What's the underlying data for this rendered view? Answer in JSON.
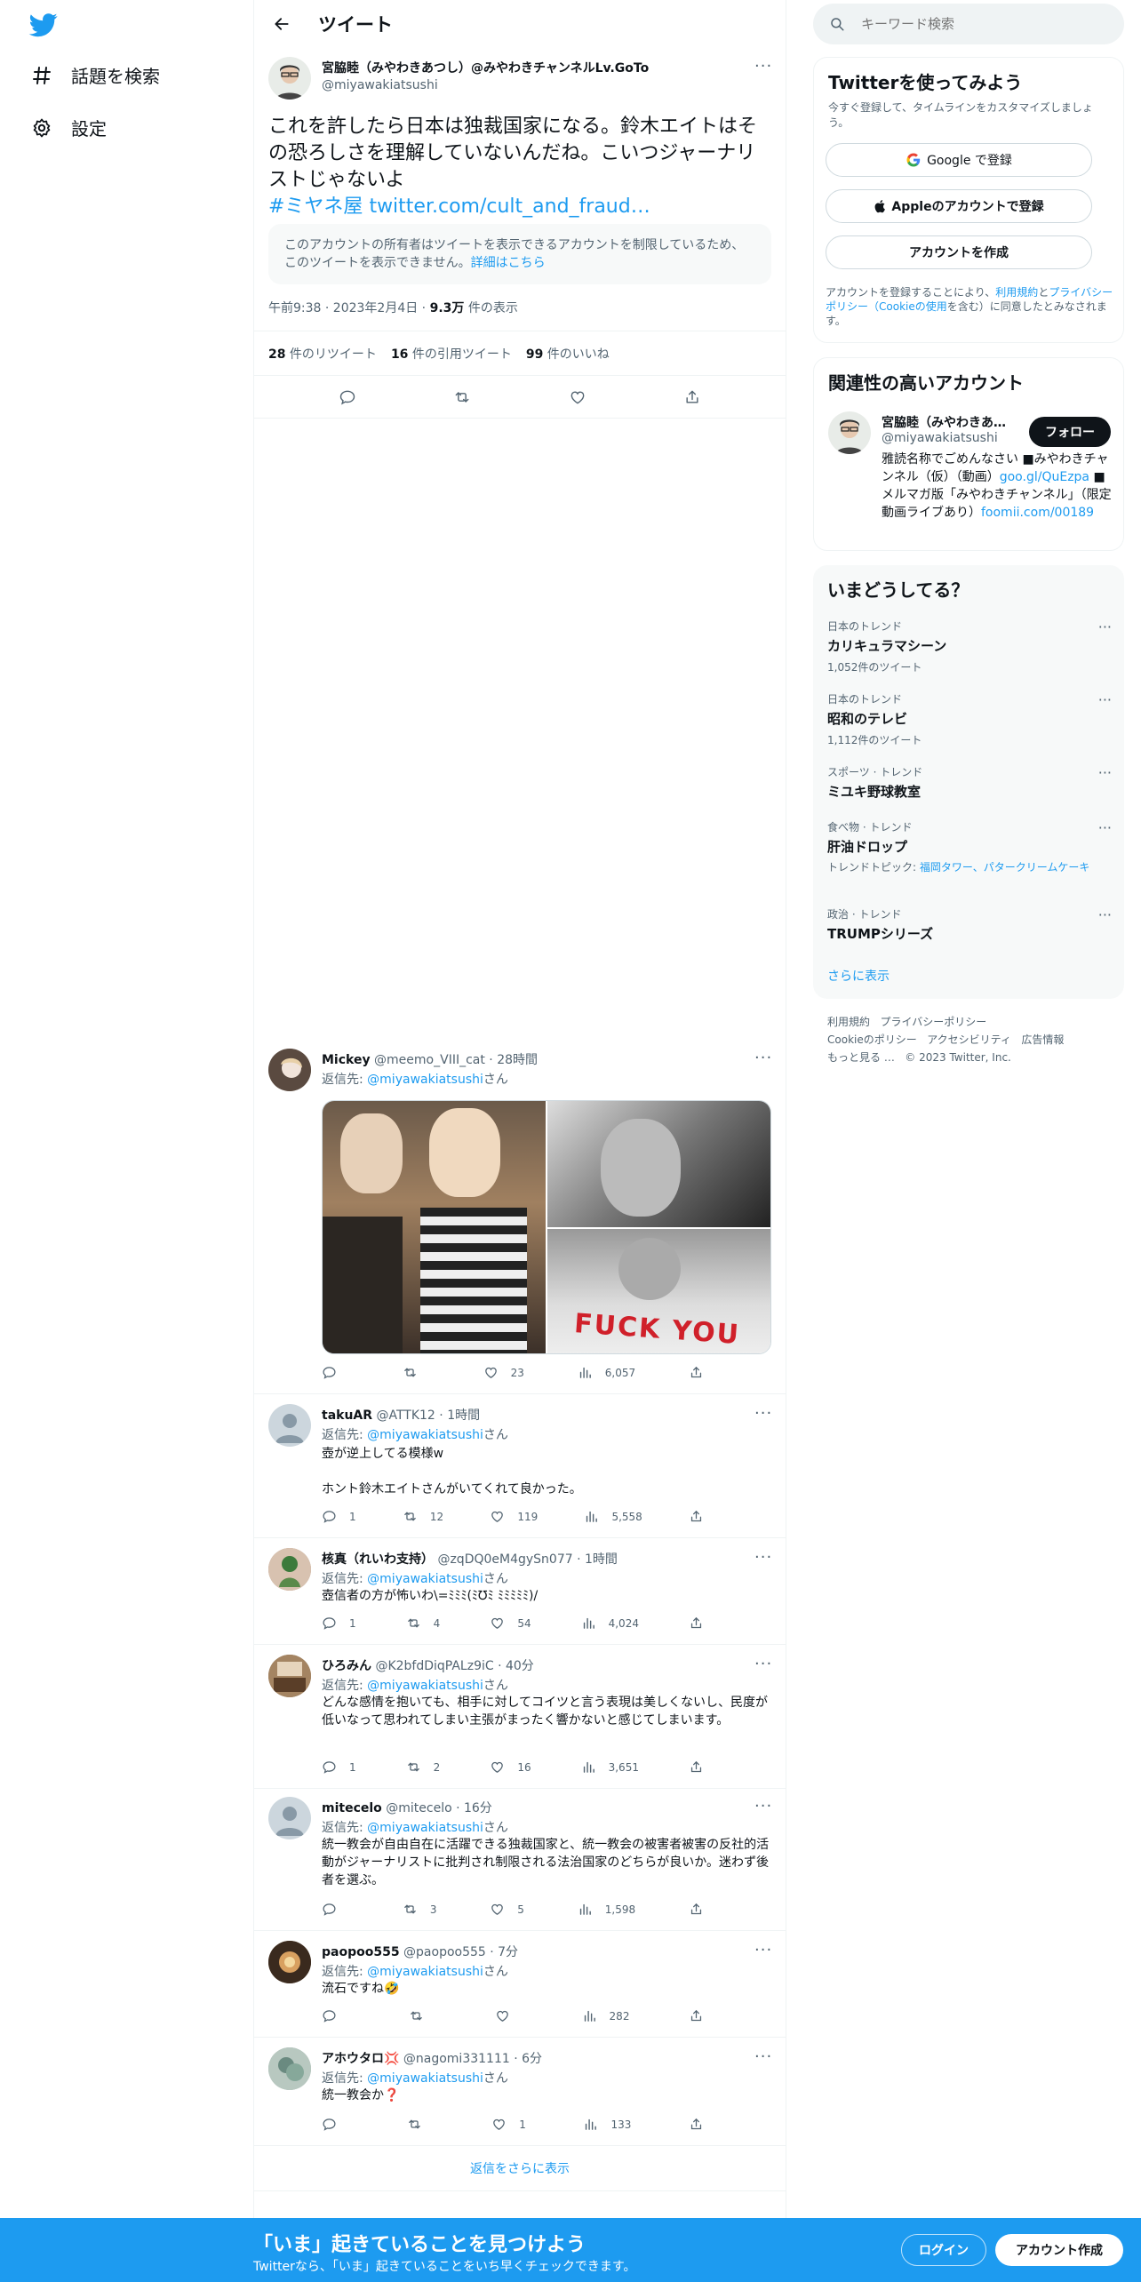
{
  "nav": {
    "explore": "話題を検索",
    "settings": "設定"
  },
  "header": {
    "title": "ツイート"
  },
  "tweet": {
    "name": "宮脇睦（みやわきあつし）@みやわきチャンネルLv.GoTo",
    "handle": "@miyawakiatsushi",
    "text": "これを許したら日本は独裁国家になる。鈴木エイトはその恐ろしさを理解していないんだね。こいつジャーナリストじゃないよ",
    "hashtag": "#ミヤネ屋",
    "link": "twitter.com/cult_and_fraud…",
    "quote_notice": "このアカウントの所有者はツイートを表示できるアカウントを制限しているため、このツイートを表示できません。",
    "quote_link": "詳細はこちら",
    "time": "午前9:38 · 2023年2月4日 · ",
    "views_count": "9.3万",
    "views_label": " 件の表示",
    "retweets_count": "28",
    "retweets_label": " 件のリツイート",
    "quotes_count": "16",
    "quotes_label": " 件の引用ツイート",
    "likes_count": "99",
    "likes_label": " 件のいいね"
  },
  "reply_to_prefix": "返信先: ",
  "reply_to_user": "@miyawakiatsushi",
  "reply_to_suffix": "さん",
  "replies": [
    {
      "name": "Mickey",
      "handle": "@meemo_VIII_cat · 28時間",
      "text": "",
      "replies": "",
      "retweets": "",
      "likes": "23",
      "views": "6,057",
      "color": "#c9b7a5"
    },
    {
      "name": "takuAR",
      "handle": "@ATTK12 · 1時間",
      "text": "壺が逆上してる模様w\n\nホント鈴木エイトさんがいてくれて良かった。",
      "replies": "1",
      "retweets": "12",
      "likes": "119",
      "views": "5,558",
      "color": "#ccd6dd"
    },
    {
      "name": "核真（れいわ支持）",
      "handle": "@zqDQ0eM4gySn077 · 1時間",
      "text": "壺信者の方が怖いわ\\=ﾐﾐﾐ(ﾐ℧ﾐ ﾐﾐﾐﾐﾐ)/",
      "replies": "1",
      "retweets": "4",
      "likes": "54",
      "views": "4,024",
      "color": "#b38e76"
    },
    {
      "name": "ひろみん",
      "handle": "@K2bfdDiqPALz9iC · 40分",
      "text": "どんな感情を抱いても、相手に対してコイツと言う表現は美しくないし、民度が低いなって思われてしまい主張がまったく響かないと感じてしまいます。",
      "replies": "1",
      "retweets": "2",
      "likes": "16",
      "views": "3,651",
      "color": "#9a7a5a"
    },
    {
      "name": "mitecelo",
      "handle": "@mitecelo · 16分",
      "text": "統一教会が自由自在に活躍できる独裁国家と、統一教会の被害者被害の反社的活動がジャーナリストに批判され制限される法治国家のどちらが良いか。迷わず後者を選ぶ。",
      "replies": "",
      "retweets": "3",
      "likes": "5",
      "views": "1,598",
      "color": "#ccd6dd"
    },
    {
      "name": "paopoo555",
      "handle": "@paopoo555 · 7分",
      "text": "流石ですね🤣",
      "replies": "",
      "retweets": "",
      "likes": "",
      "views": "282",
      "color": "#8a6a4a"
    },
    {
      "name": "アホウタロ💢",
      "handle": "@nagomi331111 · 6分",
      "text": "統一教会か❓",
      "replies": "",
      "retweets": "",
      "likes": "1",
      "views": "133",
      "color": "#9db0a8"
    }
  ],
  "show_more_replies": "返信をさらに表示",
  "search": {
    "placeholder": "キーワード検索"
  },
  "signup": {
    "title": "Twitterを使ってみよう",
    "subtitle": "今すぐ登録して、タイムラインをカスタマイズしましょう。",
    "google": "Google で登録",
    "apple": "Appleのアカウントで登録",
    "create": "アカウントを作成",
    "terms_1": "アカウントを登録することにより、",
    "terms_link1": "利用規約",
    "terms_2": "と",
    "terms_link2": "プライバシーポリシー（Cookieの使用",
    "terms_3": "を含む）に同意したとみなされます。"
  },
  "related": {
    "title": "関連性の高いアカウント",
    "name": "宮脇睦（みやわきあ…",
    "handle": "@miyawakiatsushi",
    "follow": "フォロー",
    "bio_1": "雅読名称でごめんなさい ■みやわきチャンネル（仮）（動画）",
    "bio_link1": "goo.gl/QuEzpa",
    "bio_2": " ■メルマガ版「みやわきチャンネル」（限定動画ライブあり）",
    "bio_link2": "foomii.com/00189"
  },
  "trends": {
    "title": "いまどうしてる？",
    "items": [
      {
        "context": "日本のトレンド",
        "name": "カリキュラマシーン",
        "meta": "1,052件のツイート"
      },
      {
        "context": "日本のトレンド",
        "name": "昭和のテレビ",
        "meta": "1,112件のツイート"
      },
      {
        "context": "スポーツ · トレンド",
        "name": "ミユキ野球教室",
        "meta": ""
      },
      {
        "context": "食べ物 · トレンド",
        "name": "肝油ドロップ",
        "meta_prefix": "トレンドトピック: ",
        "meta_link": "福岡タワー、パタークリームケーキ"
      },
      {
        "context": "政治 · トレンド",
        "name": "TRUMPシリーズ",
        "meta": ""
      }
    ],
    "show_more": "さらに表示"
  },
  "footer": {
    "l1": "利用規約",
    "l2": "プライバシーポリシー",
    "l3": "Cookieのポリシー",
    "l4": "アクセシビリティ",
    "l5": "広告情報",
    "l6": "もっと見る …",
    "copyright": "© 2023 Twitter, Inc."
  },
  "bottombar": {
    "title": "「いま」起きていることを見つけよう",
    "subtitle": "Twitterなら、「いま」起きていることをいち早くチェックできます。",
    "login": "ログイン",
    "signup": "アカウント作成"
  },
  "colors": {
    "accent": "#1d9bf0",
    "text": "#0f1419",
    "muted": "#536471"
  }
}
